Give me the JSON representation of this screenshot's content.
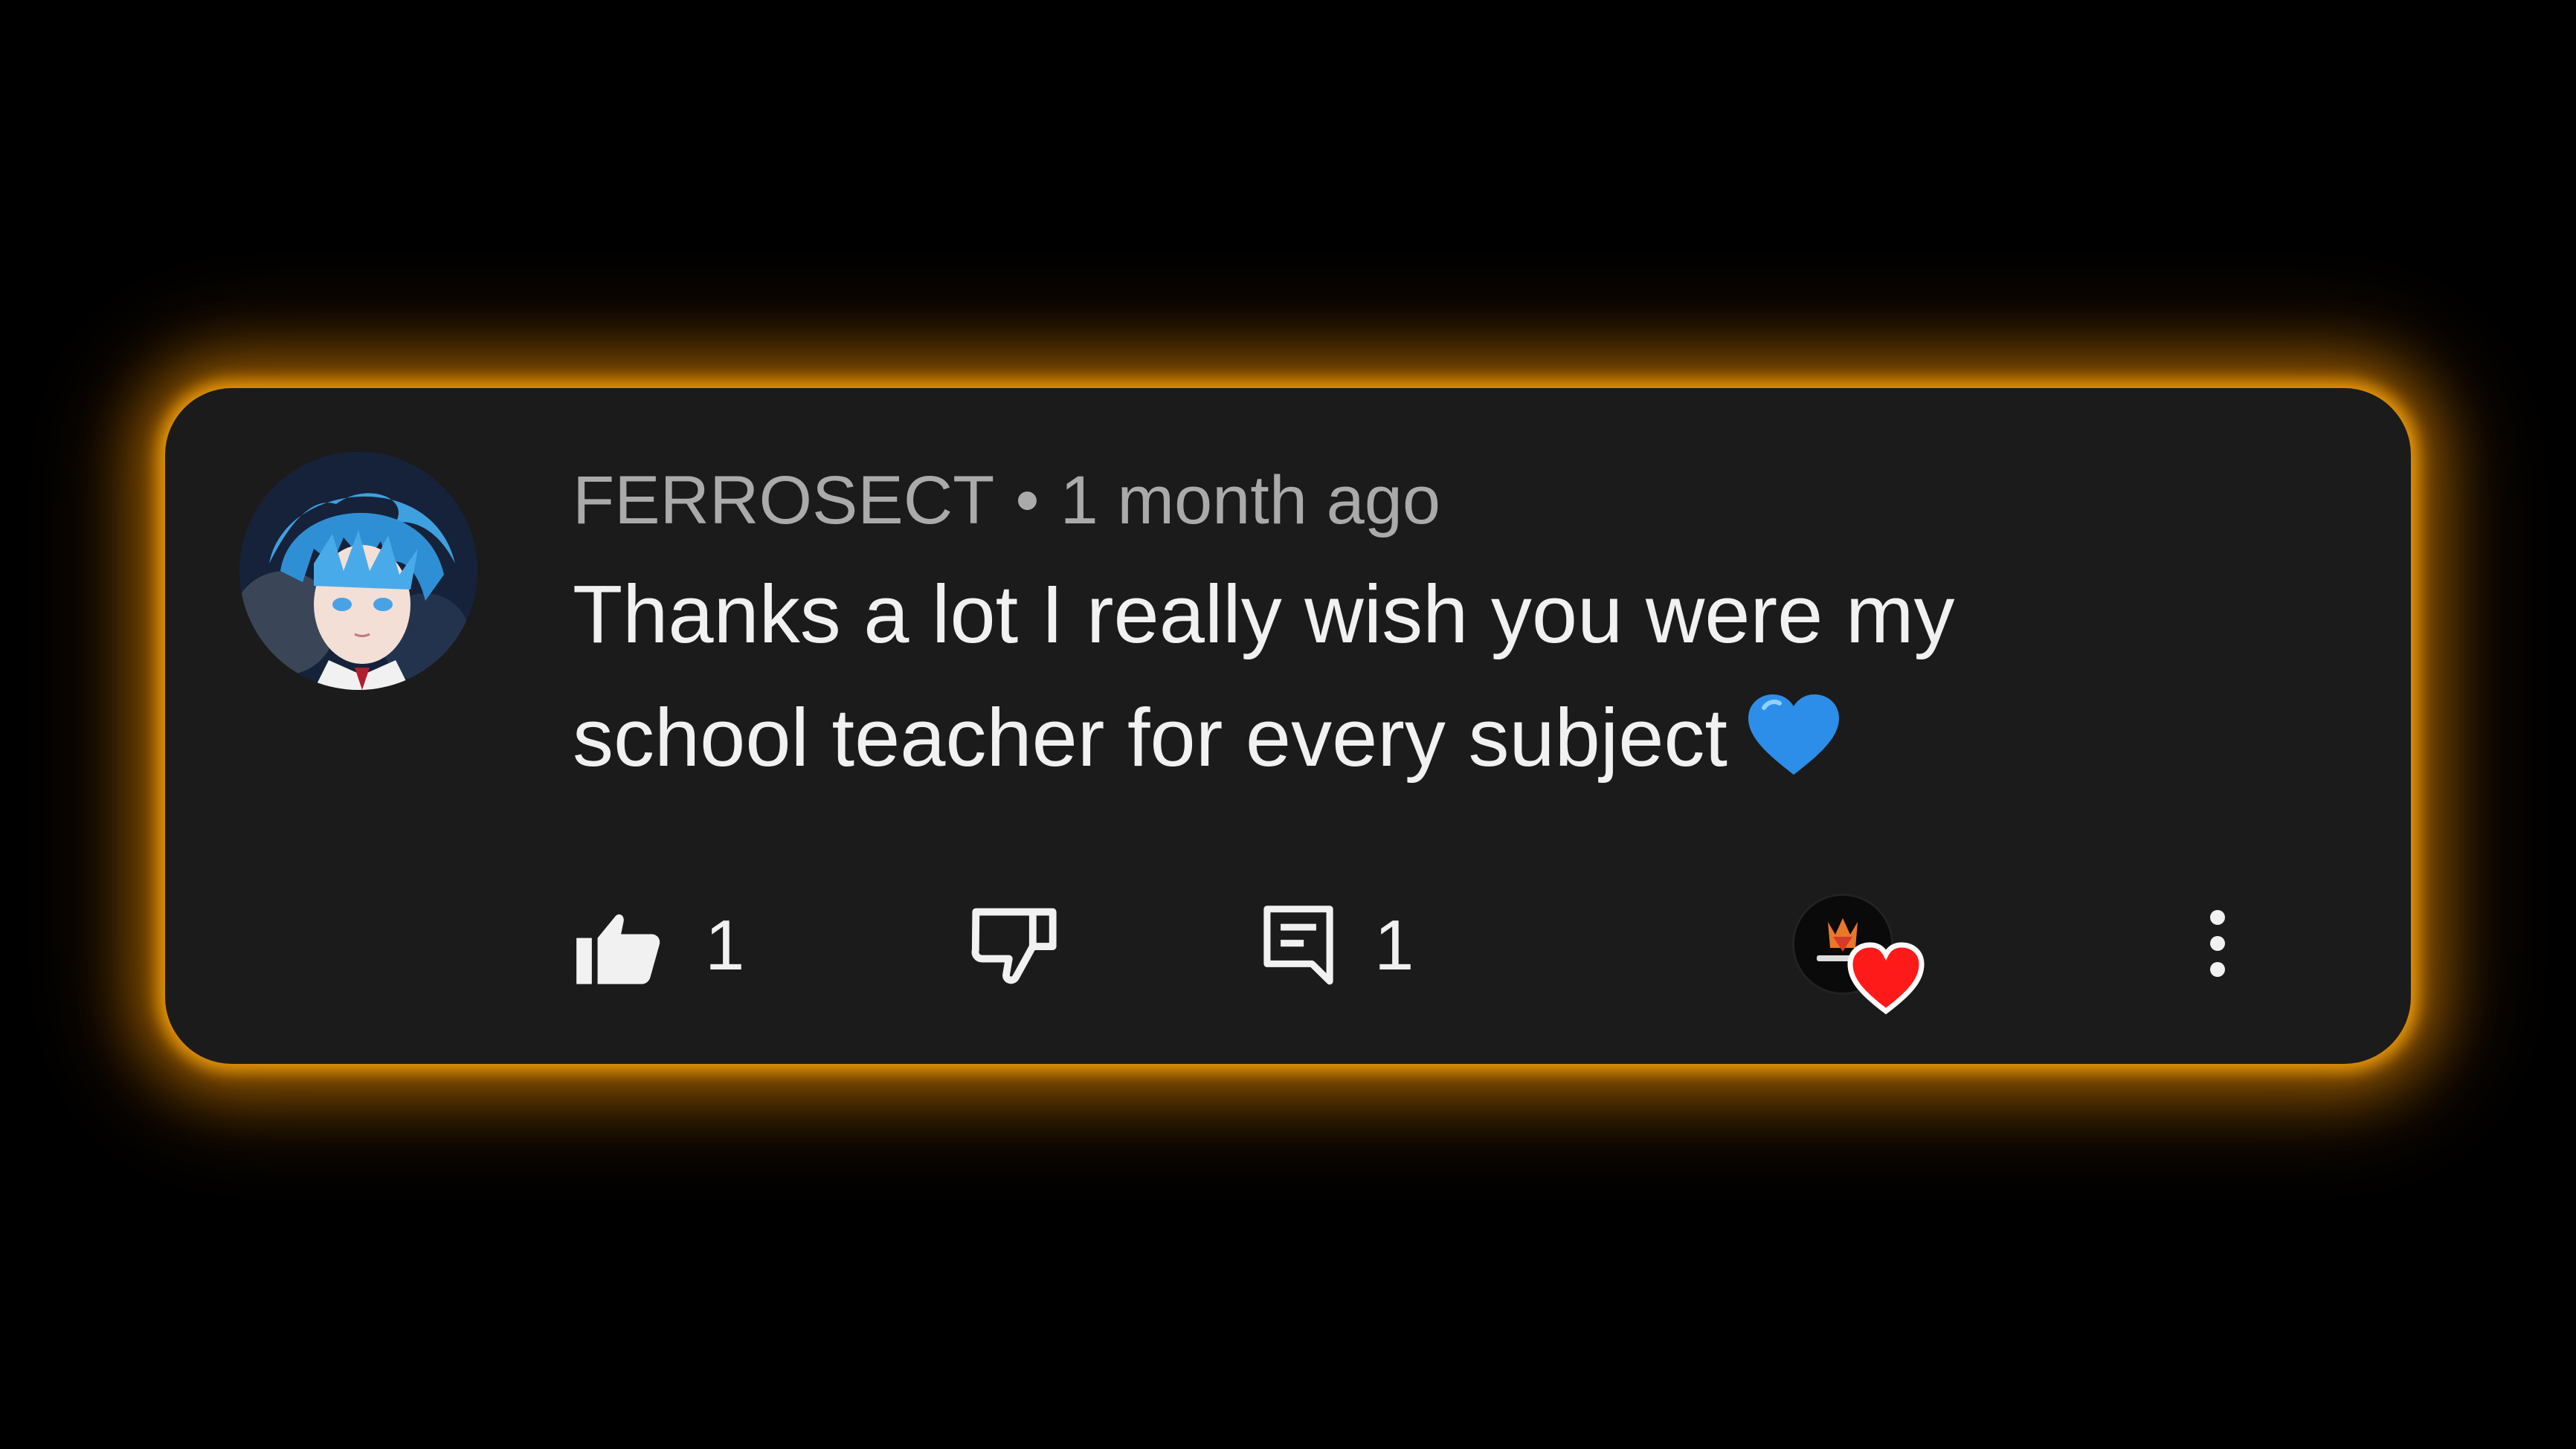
{
  "comment": {
    "author": "FERROSECT",
    "separator": "•",
    "timestamp": "1 month ago",
    "text": "Thanks a lot I really wish you were my school teacher for every subject",
    "emoji": "blue-heart",
    "avatar": "anime-blue-hair-avatar"
  },
  "actions": {
    "like_count": "1",
    "reply_count": "1",
    "like_icon": "thumbs-up-filled-icon",
    "dislike_icon": "thumbs-down-outline-icon",
    "reply_icon": "comment-reply-icon",
    "creator_heart": "creator-avatar-with-red-heart",
    "more_icon": "vertical-ellipsis-icon"
  },
  "colors": {
    "background": "#000000",
    "card": "#1b1b1b",
    "glow": "#e89a0a",
    "meta_text": "#aaaaaa",
    "body_text": "#f1f1f1",
    "heart_red": "#ff1a1a",
    "emoji_blue": "#2c8ee8"
  }
}
